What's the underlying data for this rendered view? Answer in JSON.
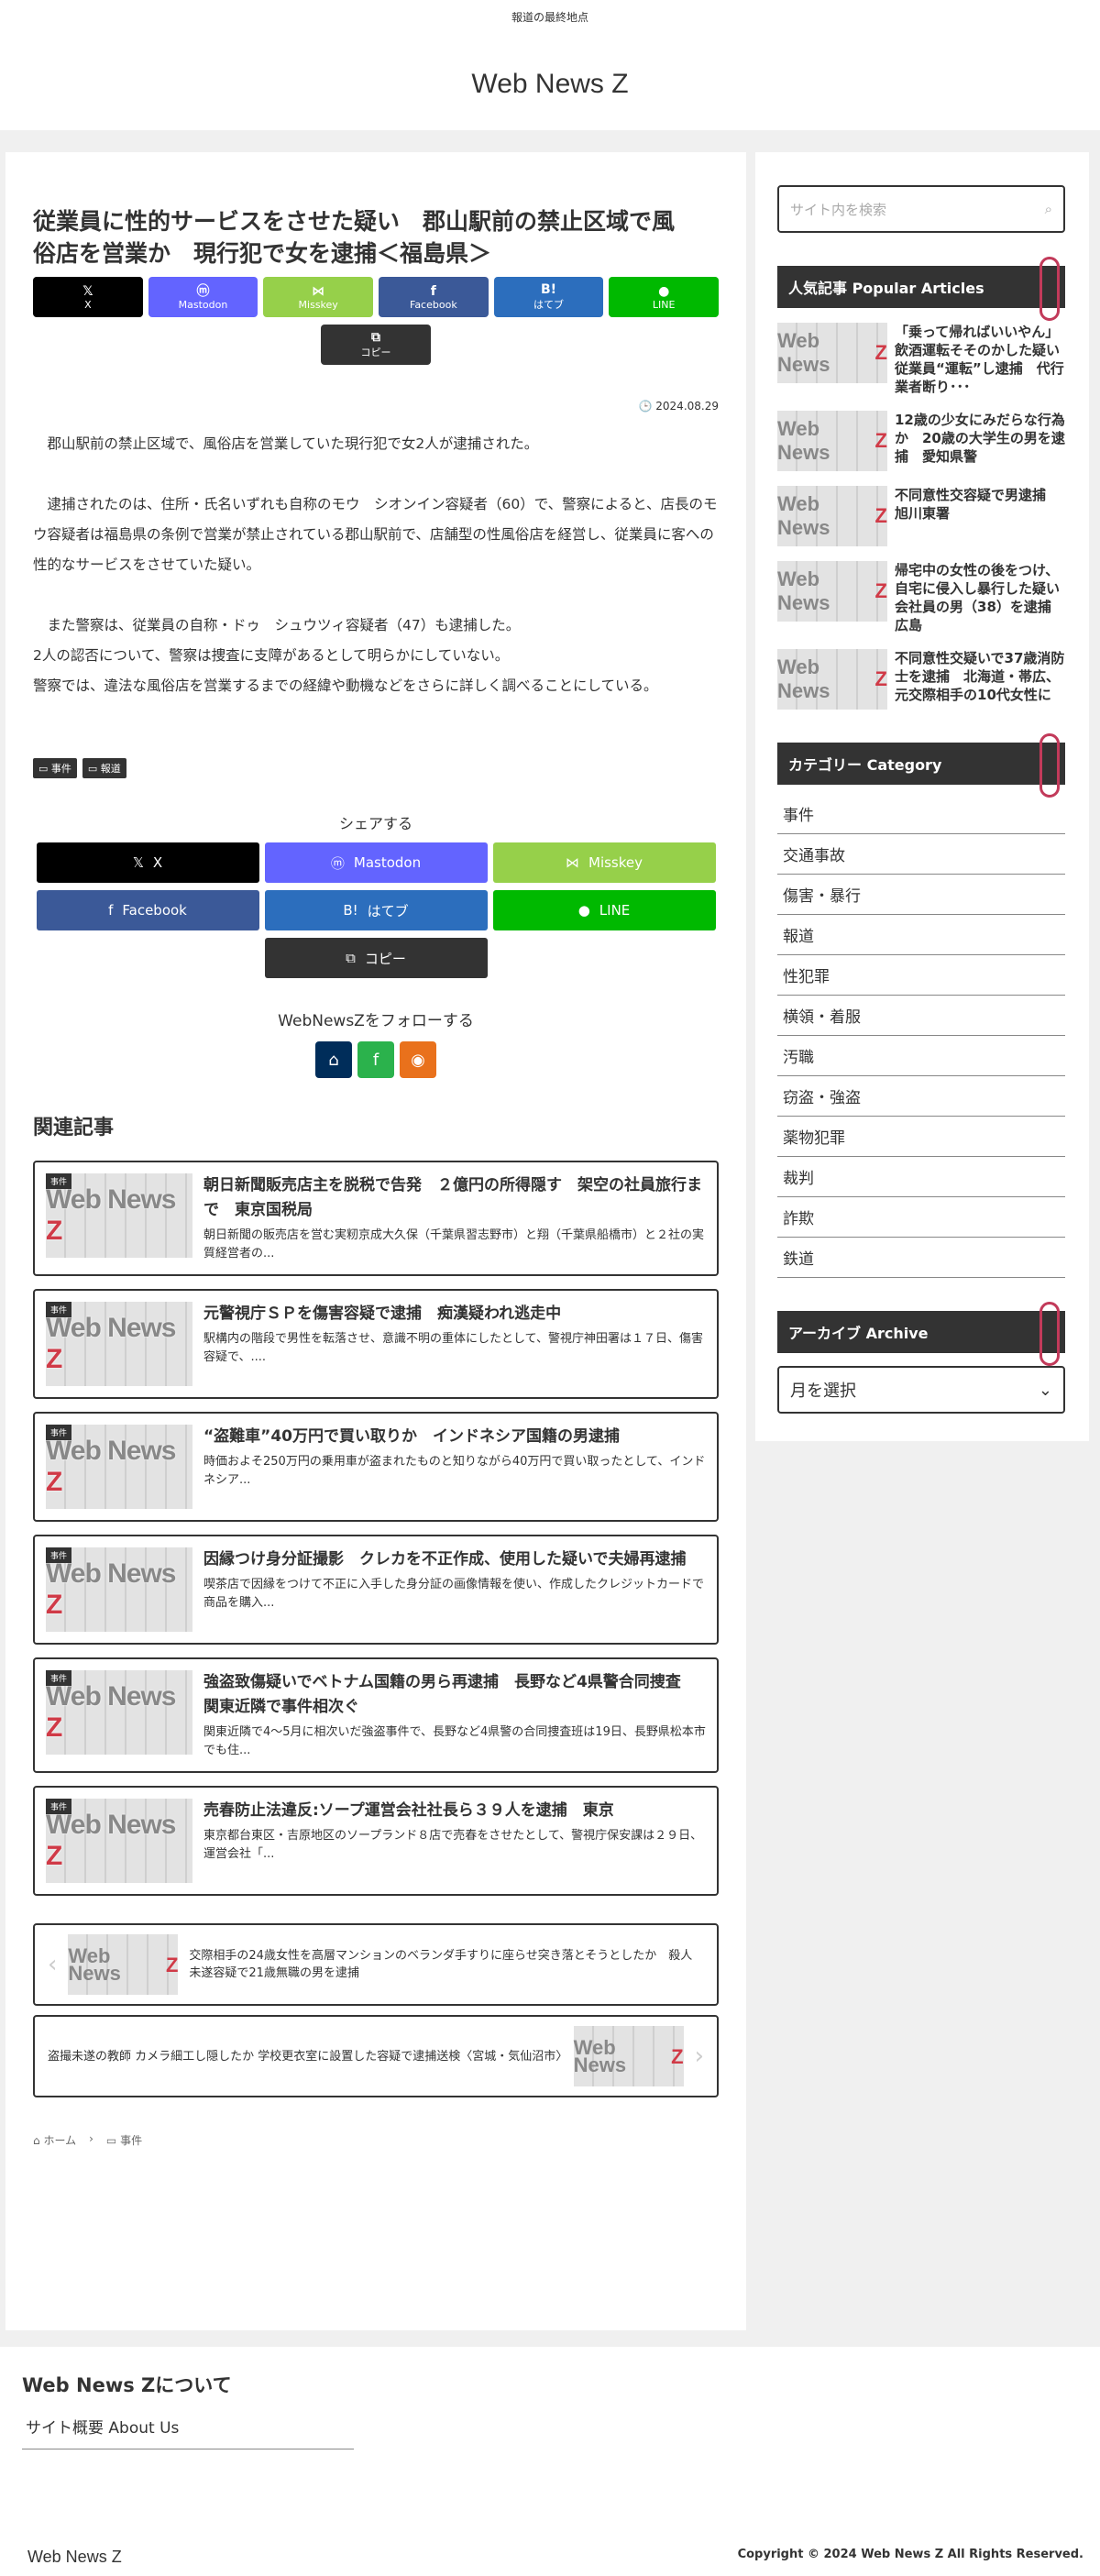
{
  "header": {
    "tagline": "報道の最終地点",
    "site_title": "Web News Z"
  },
  "article": {
    "title": "従業員に性的サービスをさせた疑い　郡山駅前の禁止区域で風俗店を営業か　現行犯で女を逮捕＜福島県＞",
    "share_top": [
      {
        "icon": "𝕏",
        "label": "X",
        "color": "#000000"
      },
      {
        "icon": "ⓜ",
        "label": "Mastodon",
        "color": "#6364ff"
      },
      {
        "icon": "⋈",
        "label": "Misskey",
        "color": "#96d04a"
      },
      {
        "icon": "f",
        "label": "Facebook",
        "color": "#3b5998"
      },
      {
        "icon": "B!",
        "label": "はてブ",
        "color": "#2c6ebd"
      },
      {
        "icon": "●",
        "label": "LINE",
        "color": "#00b900"
      }
    ],
    "copy_label": "コピー",
    "copy_icon": "⧉",
    "date": "2024.08.29",
    "paragraphs": [
      "　郡山駅前の禁止区域で、風俗店を営業していた現行犯で女2人が逮捕された。",
      "",
      "　逮捕されたのは、住所・氏名いずれも自称のモウ　シオンイン容疑者（60）で、警察によると、店長のモウ容疑者は福島県の条例で営業が禁止されている郡山駅前で、店舗型の性風俗店を経営し、従業員に客への性的なサービスをさせていた疑い。",
      "",
      "　また警察は、従業員の自称・ドゥ　シュウツィ容疑者（47）も逮捕した。",
      "2人の認否について、警察は捜査に支障があるとして明らかにしていない。",
      "警察では、違法な風俗店を営業するまでの経緯や動機などをさらに詳しく調べることにしている。"
    ],
    "tags": [
      "事件",
      "報道"
    ],
    "share_title": "シェアする",
    "share_bottom": [
      {
        "icon": "𝕏",
        "label": "X",
        "color": "#000000"
      },
      {
        "icon": "ⓜ",
        "label": "Mastodon",
        "color": "#6364ff"
      },
      {
        "icon": "⋈",
        "label": "Misskey",
        "color": "#96d04a"
      },
      {
        "icon": "f",
        "label": "Facebook",
        "color": "#3b5998"
      },
      {
        "icon": "B!",
        "label": "はてブ",
        "color": "#2c6ebd"
      },
      {
        "icon": "●",
        "label": "LINE",
        "color": "#00b900"
      }
    ],
    "follow_title": "WebNewsZをフォローする",
    "follow_icons": [
      {
        "name": "home-icon",
        "glyph": "⌂",
        "color": "#002d5a"
      },
      {
        "name": "feedly-icon",
        "glyph": "f",
        "color": "#2bb24c"
      },
      {
        "name": "rss-icon",
        "glyph": "◉",
        "color": "#e9711c"
      }
    ],
    "thumb_logo_a": "Web News ",
    "thumb_logo_b": "Z",
    "related_title": "関連記事",
    "related": [
      {
        "badge": "事件",
        "title": "朝日新聞販売店主を脱税で告発　２億円の所得隠す　架空の社員旅行まで　東京国税局",
        "snippet": "朝日新聞の販売店を営む実籾京成大久保（千葉県習志野市）と翔（千葉県船橋市）と２社の実質経営者の..."
      },
      {
        "badge": "事件",
        "title": "元警視庁ＳＰを傷害容疑で逮捕　痴漢疑われ逃走中",
        "snippet": "駅構内の階段で男性を転落させ、意識不明の重体にしたとして、警視庁神田署は１７日、傷害容疑で、...."
      },
      {
        "badge": "事件",
        "title": "“盗難車”40万円で買い取りか　インドネシア国籍の男逮捕",
        "snippet": "時価およそ250万円の乗用車が盗まれたものと知りながら40万円で買い取ったとして、インドネシア..."
      },
      {
        "badge": "事件",
        "title": "因縁つけ身分証撮影　クレカを不正作成、使用した疑いで夫婦再逮捕",
        "snippet": "喫茶店で因縁をつけて不正に入手した身分証の画像情報を使い、作成したクレジットカードで商品を購入..."
      },
      {
        "badge": "事件",
        "title": "強盗致傷疑いでベトナム国籍の男ら再逮捕　長野など4県警合同捜査　関東近隣で事件相次ぐ",
        "snippet": "関東近隣で4～5月に相次いだ強盗事件で、長野など4県警の合同捜査班は19日、長野県松本市でも住..."
      },
      {
        "badge": "事件",
        "title": "売春防止法違反:ソープ運営会社社長ら３９人を逮捕　東京",
        "snippet": "東京都台東区・吉原地区のソープランド８店で売春をさせたとして、警視庁保安課は２９日、運営会社「..."
      }
    ],
    "prev": {
      "arrow": "‹",
      "text": "交際相手の24歳女性を高層マンションのベランダ手すりに座らせ突き落とそうとしたか　殺人未遂容疑で21歳無職の男を逮捕"
    },
    "next": {
      "arrow": "›",
      "text": "盗撮未遂の教師 カメラ細工し隠したか 学校更衣室に設置した容疑で逮捕送検〈宮城・気仙沼市〉"
    },
    "breadcrumb": {
      "home_icon": "⌂",
      "home": "ホーム",
      "sep_icon": "›",
      "folder_icon": "▭",
      "cat": "事件"
    }
  },
  "sidebar": {
    "search_placeholder": "サイト内を検索",
    "search_icon": "⌕",
    "popular_title": "人気記事 Popular Articles",
    "popular": [
      "「乗って帰ればいいやん」飲酒運転そそのかした疑い　従業員“運転”し逮捕　代行業者断り･･･",
      "12歳の少女にみだらな行為か　20歳の大学生の男を逮捕　愛知県警",
      "不同意性交容疑で男逮捕　旭川東署",
      "帰宅中の女性の後をつけ、自宅に侵入し暴行した疑い　会社員の男（38）を逮捕　広島",
      "不同意性交疑いで37歳消防士を逮捕　北海道・帯広、元交際相手の10代女性に"
    ],
    "category_title": "カテゴリー Category",
    "categories": [
      "事件",
      "交通事故",
      "傷害・暴行",
      "報道",
      "性犯罪",
      "横領・着服",
      "汚職",
      "窃盗・強盗",
      "薬物犯罪",
      "裁判",
      "詐欺",
      "鉄道"
    ],
    "archive_title": "アーカイブ Archive",
    "archive_select": "月を選択",
    "archive_chevron": "⌄"
  },
  "footer": {
    "about_title": "Web News Zについて",
    "about_link": "サイト概要 About Us",
    "site_name": "Web News Z",
    "copyright": "Copyright © 2024 Web News Z All Rights Reserved."
  },
  "colors": {
    "accent": "#333333",
    "clip": "#c23a5a"
  }
}
